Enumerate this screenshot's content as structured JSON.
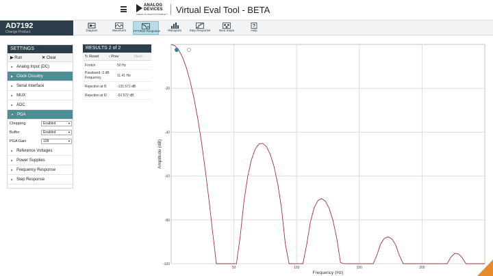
{
  "topbar": {
    "menu_icon": "hamburger-icon",
    "logo": {
      "line1": "ANALOG",
      "line2": "DEVICES",
      "tagline": "AHEAD OF WHAT'S POSSIBLE™"
    },
    "title": "Virtual Eval Tool - BETA"
  },
  "product": {
    "name": "AD7192",
    "subtitle": "Change Product"
  },
  "toolbar": {
    "items": [
      {
        "label": "Diagram",
        "icon": "diagram-icon"
      },
      {
        "label": "Waveform",
        "icon": "waveform-icon"
      },
      {
        "label": "FFT/ROI Response",
        "icon": "fft-response-icon",
        "active": true
      },
      {
        "label": "Histogram",
        "icon": "histogram-icon"
      },
      {
        "label": "Step Response",
        "icon": "step-response-icon"
      },
      {
        "label": "Next Steps",
        "icon": "next-steps-icon"
      },
      {
        "label": "Help",
        "icon": "help-icon"
      }
    ]
  },
  "settings": {
    "title": "SETTINGS",
    "run_label": "Run",
    "clear_label": "Clear",
    "sections": [
      "Analog Input (DC)",
      "Clock Circuitry",
      "Serial Interface",
      "MUX",
      "ADC",
      "PGA"
    ],
    "pga_fields": [
      {
        "label": "Chopping",
        "value": "Enabled"
      },
      {
        "label": "Buffer",
        "value": "Enabled"
      },
      {
        "label": "PGA Gain",
        "value": "128"
      }
    ],
    "sections_after": [
      "Reference Voltages",
      "Power Supplies",
      "Frequency Response",
      "Step Response"
    ]
  },
  "results": {
    "title": "RESULTS",
    "counter": "2 of 2",
    "reset_label": "Reset",
    "prev_label": "Prev",
    "next_label": "Next",
    "rows": [
      {
        "key": "Fnotch",
        "value": "50 Hz"
      },
      {
        "key": "Passband -3 dB Frequency",
        "value": "11.41 Hz"
      },
      {
        "key": "Rejection at f1",
        "value": "-131.572 dB"
      },
      {
        "key": "Rejection at f2",
        "value": "-52.572 dB"
      }
    ]
  },
  "chart_data": {
    "type": "line",
    "xlabel": "Frequency (Hz)",
    "ylabel": "Amplitude (dB)",
    "xlim": [
      0,
      250
    ],
    "ylim": [
      -100,
      0
    ],
    "x_ticks": [
      "50",
      "100",
      "150",
      "200"
    ],
    "y_ticks": [
      "-20",
      "-40",
      "-60",
      "-80",
      "-100"
    ],
    "grid": true,
    "line_color": "#a0323e",
    "series": [
      {
        "x": [
          0,
          3,
          6,
          9,
          12,
          15,
          18,
          21,
          24,
          27,
          30,
          33,
          36,
          39,
          42,
          45,
          48,
          50,
          52,
          55,
          58,
          61,
          64,
          67,
          70,
          73,
          76,
          79,
          82,
          85,
          88,
          91,
          94,
          97,
          100,
          102,
          105,
          108,
          111,
          114,
          117,
          120,
          123,
          126,
          129,
          132,
          135,
          138,
          141,
          144,
          147,
          150,
          152,
          155,
          158,
          161,
          164,
          167,
          170,
          173,
          176,
          179,
          182,
          185,
          188,
          191,
          194,
          197,
          200,
          202,
          205,
          208,
          211,
          214,
          217,
          220,
          223,
          226,
          229,
          232,
          235,
          238,
          241,
          244,
          247,
          250
        ],
        "y": [
          0,
          -0.6,
          -2.6,
          -5.8,
          -10.5,
          -16.5,
          -24.1,
          -33.2,
          -44.0,
          -56.5,
          -70.4,
          -85.5,
          -100,
          -100,
          -100,
          -100,
          -100,
          -100,
          -100,
          -87.6,
          -71.5,
          -60.2,
          -52.6,
          -47.8,
          -45.4,
          -45.1,
          -46.6,
          -50.1,
          -55.7,
          -63.7,
          -74.9,
          -91.0,
          -100,
          -100,
          -100,
          -100,
          -100,
          -91.3,
          -80.9,
          -74.5,
          -71.2,
          -70.3,
          -71.5,
          -74.8,
          -80.3,
          -88.4,
          -99.5,
          -100,
          -100,
          -100,
          -100,
          -100,
          -100,
          -100,
          -100,
          -100,
          -96.1,
          -91.0,
          -88.4,
          -87.8,
          -88.7,
          -91.5,
          -96.3,
          -100,
          -100,
          -100,
          -100,
          -100,
          -100,
          -100,
          -100,
          -100,
          -100,
          -100,
          -100,
          -100,
          -97.0,
          -95.3,
          -95.5,
          -97.3,
          -100,
          -100,
          -100,
          -100,
          -100,
          -100
        ]
      }
    ]
  }
}
